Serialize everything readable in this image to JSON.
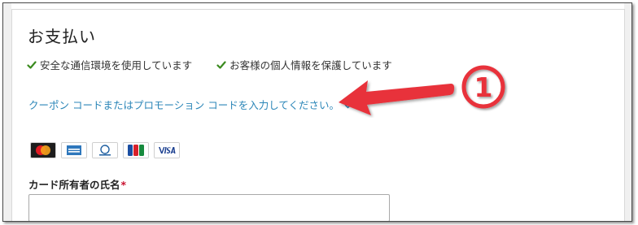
{
  "payment": {
    "title": "お支払い",
    "secure_items": [
      {
        "label": "安全な通信環境を使用しています",
        "icon": "checkmark-icon"
      },
      {
        "label": "お客様の個人情報を保護しています",
        "icon": "checkmark-icon"
      }
    ],
    "coupon_link": "クーポン コードまたはプロモーション コードを入力してください。",
    "card_brands": [
      "MasterCard",
      "American Express",
      "Diners Club",
      "JCB",
      "VISA"
    ],
    "cardholder": {
      "label": "カード所有者の氏名",
      "required_mark": "*",
      "value": "",
      "placeholder": ""
    }
  },
  "annotation": {
    "number": "1",
    "arrow_color": "#e8313a",
    "number_color": "#e8313a"
  },
  "colors": {
    "check_green": "#3a8a1e",
    "link_blue": "#2b86b8",
    "required_red": "#c8102e"
  }
}
